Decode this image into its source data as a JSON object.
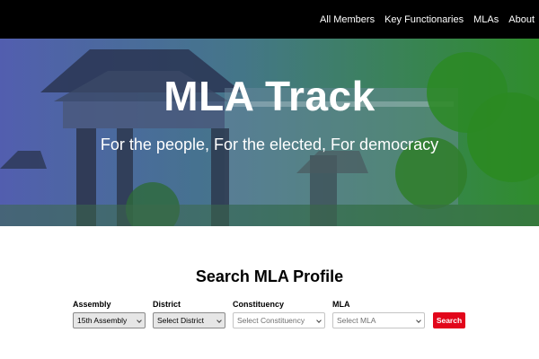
{
  "nav": {
    "items": [
      "All Members",
      "Key Functionaries",
      "MLAs",
      "About"
    ]
  },
  "hero": {
    "title": "MLA Track",
    "subtitle": "For the people, For the elected, For democracy"
  },
  "search": {
    "title": "Search MLA Profile",
    "fields": [
      {
        "label": "Assembly",
        "value": "15th Assembly"
      },
      {
        "label": "District",
        "value": "Select District"
      },
      {
        "label": "Constituency",
        "value": "Select Constituency"
      },
      {
        "label": "MLA",
        "value": "Select MLA"
      }
    ],
    "button_label": "Search"
  },
  "colors": {
    "nav_bg": "#000000",
    "button": "#e2061b"
  }
}
